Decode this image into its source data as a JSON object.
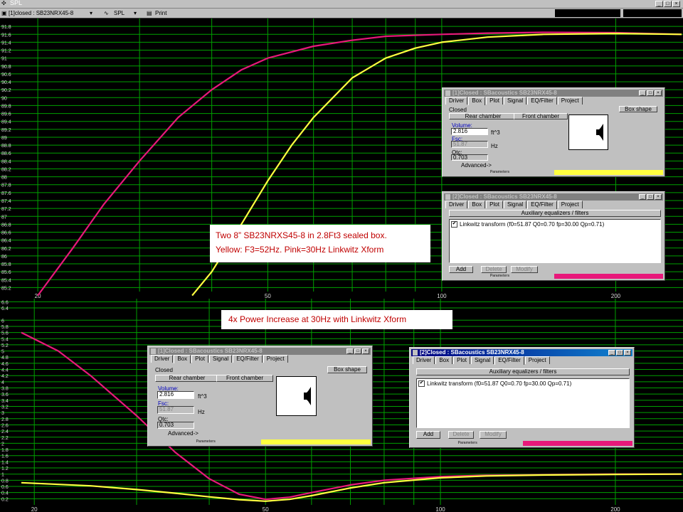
{
  "window": {
    "title": "SPL"
  },
  "toolbar": {
    "selector": "[1]closed : SB23NRX45-8",
    "view_label": "SPL",
    "print_label": "Print"
  },
  "top_chart": {
    "yticks": [
      "91.8",
      "91.6",
      "91.4",
      "91.2",
      "91",
      "90.8",
      "90.6",
      "90.4",
      "90.2",
      "90",
      "89.8",
      "89.6",
      "89.4",
      "89.2",
      "89",
      "88.8",
      "88.6",
      "88.4",
      "88.2",
      "88",
      "87.8",
      "87.6",
      "87.4",
      "87.2",
      "87",
      "86.8",
      "86.6",
      "86.4",
      "86.2",
      "86",
      "85.8",
      "85.6",
      "85.4",
      "85.2"
    ],
    "xticks": [
      "20",
      "50",
      "100",
      "200"
    ]
  },
  "bottom_chart": {
    "yticks": [
      "6.6",
      "6.4",
      "6",
      "5.8",
      "5.6",
      "5.4",
      "5.2",
      "5",
      "4.8",
      "4.6",
      "4.4",
      "4.2",
      "4",
      "3.8",
      "3.6",
      "3.4",
      "3.2",
      "3",
      "2.8",
      "2.6",
      "2.4",
      "2.2",
      "2",
      "1.8",
      "1.6",
      "1.4",
      "1.2",
      "1",
      "0.8",
      "0.6",
      "0.4",
      "0.2"
    ],
    "xticks": [
      "20",
      "50",
      "100",
      "200"
    ]
  },
  "captions": {
    "spl_line1": "Two  8” SB23NRXS45-8  in 2.8Ft3 sealed box.",
    "spl_line2": "Yellow: F3=52Hz.  Pink=30Hz Linkwitz Xform",
    "power": "4x Power Increase at 30Hz  with Linkwitz Xform"
  },
  "dialogs": {
    "box_top": {
      "title": "[1]Closed : SBacoustics SB23NRX45-8",
      "tabs": [
        "Driver",
        "Box",
        "Plot",
        "Signal",
        "EQ/Filter",
        "Project"
      ],
      "selected_tab": "Box",
      "type": "Closed",
      "box_shape_btn": "Box shape",
      "rear_btn": "Rear chamber",
      "front_btn": "Front chamber",
      "volume_label": "Volume:",
      "volume_value": "2.816",
      "volume_unit": "ft^3",
      "fsc_label": "Fsc:",
      "fsc_value": "51.87",
      "fsc_unit": "Hz",
      "qtc_label": "Qtc:",
      "qtc_value": "0.703",
      "advanced_btn": "Advanced->",
      "status": "Parameters"
    },
    "eq_top": {
      "title": "[2]Closed : SBacoustics SB23NRX45-8",
      "tabs": [
        "Driver",
        "Box",
        "Plot",
        "Signal",
        "EQ/Filter",
        "Project"
      ],
      "selected_tab": "EQ/Filter",
      "section": "Auxiliary equalizers / filters",
      "item": "Linkwitz transform (f0=51.87 Q0=0.70 fp=30.00 Qp=0.71)",
      "add_btn": "Add",
      "delete_btn": "Delete",
      "modify_btn": "Modify",
      "status": "Parameters"
    },
    "box_bottom": {
      "title": "[1]Closed : SBacoustics SB23NRX45-8",
      "tabs": [
        "Driver",
        "Box",
        "Plot",
        "Signal",
        "EQ/Filter",
        "Project"
      ],
      "selected_tab": "Box",
      "type": "Closed",
      "box_shape_btn": "Box shape",
      "rear_btn": "Rear chamber",
      "front_btn": "Front chamber",
      "volume_label": "Volume:",
      "volume_value": "2.816",
      "volume_unit": "ft^3",
      "fsc_label": "Fsc:",
      "fsc_value": "51.87",
      "fsc_unit": "Hz",
      "qtc_label": "Qtc:",
      "qtc_value": "0.703",
      "advanced_btn": "Advanced->",
      "status": "Parameters"
    },
    "eq_bottom": {
      "title": "[2]Closed : SBacoustics SB23NRX45-8",
      "tabs": [
        "Driver",
        "Box",
        "Plot",
        "Signal",
        "EQ/Filter",
        "Project"
      ],
      "selected_tab": "EQ/Filter",
      "section": "Auxiliary equalizers / filters",
      "item": "Linkwitz transform (f0=51.87 Q0=0.70 fp=30.00 Qp=0.71)",
      "add_btn": "Add",
      "delete_btn": "Delete",
      "modify_btn": "Modify",
      "status": "Parameters"
    }
  },
  "colors": {
    "background": "#000000",
    "grid": "#00a000",
    "yellow_curve": "#ffff40",
    "pink_curve": "#e8187a",
    "caption_text": "#c00000"
  },
  "chart_data": [
    {
      "type": "line",
      "xscale": "log",
      "xlim": [
        19,
        260
      ],
      "ylim": [
        85.1,
        92.0
      ],
      "series": [
        {
          "color": "#e8187a",
          "x": [
            20,
            23,
            26,
            30,
            35,
            40,
            45,
            50,
            60,
            70,
            80,
            100,
            120,
            150,
            200,
            260
          ],
          "y": [
            85.0,
            86.2,
            87.3,
            88.4,
            89.5,
            90.2,
            90.7,
            91.0,
            91.3,
            91.45,
            91.55,
            91.6,
            91.63,
            91.65,
            91.64,
            91.6
          ]
        },
        {
          "color": "#ffff40",
          "x": [
            37,
            40,
            45,
            50,
            55,
            60,
            70,
            80,
            90,
            100,
            120,
            150,
            200,
            260
          ],
          "y": [
            85.0,
            85.6,
            86.8,
            87.9,
            88.8,
            89.5,
            90.5,
            91.0,
            91.25,
            91.4,
            91.53,
            91.6,
            91.62,
            91.6
          ]
        }
      ]
    },
    {
      "type": "line",
      "xscale": "log",
      "xlim": [
        19,
        260
      ],
      "ylim": [
        0.0,
        6.7
      ],
      "series": [
        {
          "color": "#e8187a",
          "x": [
            19,
            22,
            25,
            30,
            35,
            40,
            45,
            50,
            55,
            60,
            70,
            80,
            100,
            120,
            150,
            200,
            260
          ],
          "y": [
            5.6,
            5.0,
            4.2,
            2.9,
            1.7,
            0.85,
            0.35,
            0.18,
            0.25,
            0.4,
            0.65,
            0.8,
            0.92,
            0.96,
            0.98,
            1.0,
            1.0
          ]
        },
        {
          "color": "#ffff40",
          "x": [
            19,
            25,
            30,
            35,
            40,
            45,
            50,
            55,
            60,
            70,
            80,
            100,
            120,
            150,
            200,
            260
          ],
          "y": [
            0.72,
            0.62,
            0.5,
            0.38,
            0.26,
            0.17,
            0.12,
            0.18,
            0.3,
            0.55,
            0.72,
            0.88,
            0.94,
            0.97,
            0.99,
            1.0
          ]
        }
      ]
    }
  ]
}
